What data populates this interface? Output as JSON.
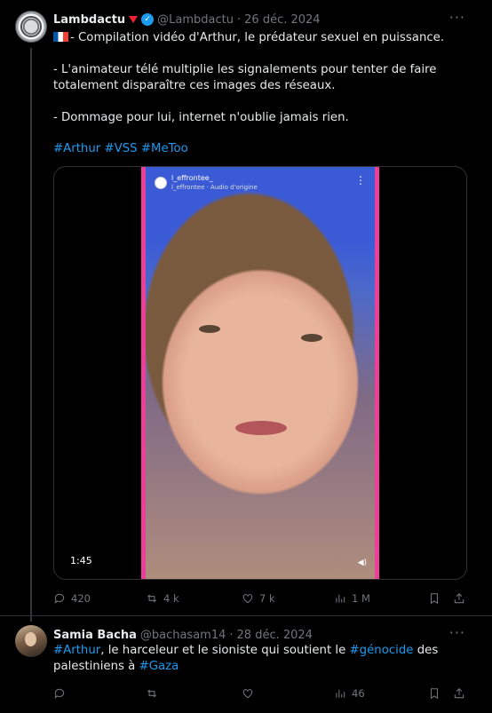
{
  "tweet1": {
    "author_name": "Lambdactu",
    "handle": "@Lambdactu",
    "separator": "·",
    "date": "26 déc. 2024",
    "line1": "- Compilation vidéo d'Arthur, le prédateur sexuel en puissance.",
    "line2": "- L'animateur télé multiplie les signalements pour tenter de faire totalement disparaître ces images des réseaux.",
    "line3": "- Dommage pour lui, internet n'oublie jamais rien.",
    "hashtags": [
      "#Arthur",
      "#VSS",
      "#MeToo"
    ],
    "video": {
      "channel": "l_effrontee_",
      "audio": "l_effrontee · Audio d'origine",
      "duration": "1:45"
    },
    "stats": {
      "replies": "420",
      "reposts": "4 k",
      "likes": "7 k",
      "views": "1 M"
    }
  },
  "tweet2": {
    "author_name": "Samia Bacha",
    "handle": "@bachasam14",
    "separator": "·",
    "date": "28 déc. 2024",
    "text_a": "#Arthur",
    "text_b": ", le harceleur et le sioniste qui soutient le ",
    "text_c": "#génocide",
    "text_d": " des palestiniens à ",
    "text_e": "#Gaza",
    "stats": {
      "views": "46"
    }
  },
  "colors": {
    "accent": "#1d9bf0",
    "muted": "#71767b",
    "background": "#000000",
    "video_border": "#ec3f9a"
  },
  "icons": [
    "more-icon",
    "verified-icon",
    "reply-icon",
    "repost-icon",
    "like-icon",
    "views-icon",
    "bookmark-icon",
    "share-icon"
  ]
}
